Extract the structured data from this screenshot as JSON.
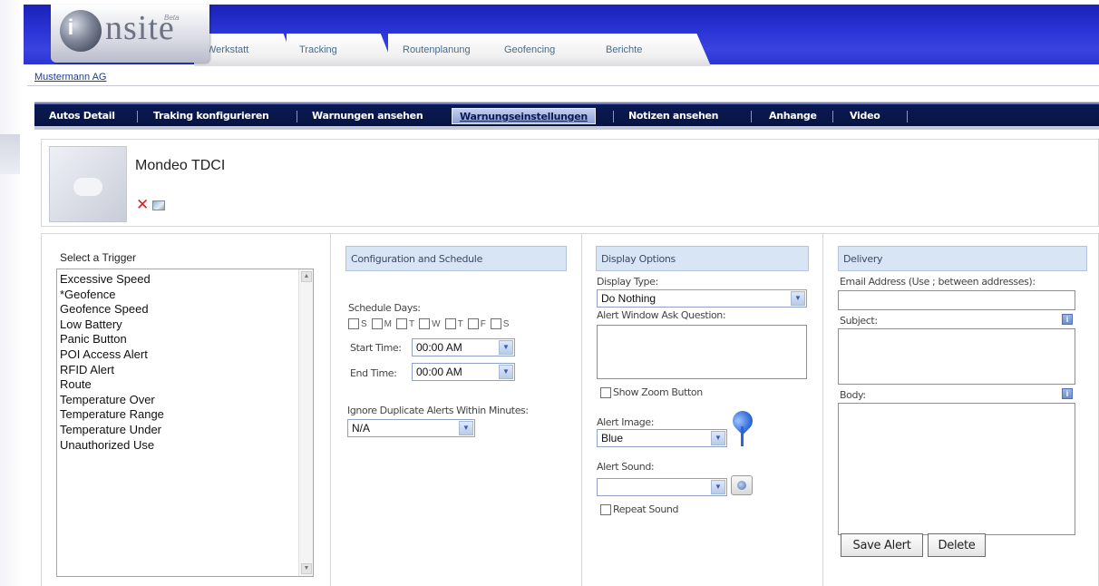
{
  "logo": {
    "ball_letter": "i",
    "word": "nsite",
    "sup": "Beta"
  },
  "tabs": [
    "Werkstatt",
    "Tracking",
    "Routenplanung",
    "Geofencing",
    "Berichte"
  ],
  "company": "Mustermann AG",
  "subnav": {
    "items": [
      "Autos Detail",
      "Traking konfigurieren",
      "Warnungen ansehen",
      "Warnungseinstellungen",
      "Notizen ansehen",
      "Anhange",
      "Video"
    ],
    "active": "Warnungseinstellungen"
  },
  "vehicle": {
    "name": "Mondeo TDCI"
  },
  "trigger": {
    "title": "Select a Trigger",
    "items": [
      "Excessive Speed",
      "*Geofence",
      "Geofence Speed",
      "Low Battery",
      "Panic Button",
      "POI Access Alert",
      "RFID Alert",
      "Route",
      "Temperature Over",
      "Temperature Range",
      "Temperature Under",
      "Unauthorized Use"
    ]
  },
  "config": {
    "header": "Configuration and Schedule",
    "schedule_days_label": "Schedule Days:",
    "days": [
      "S",
      "M",
      "T",
      "W",
      "T",
      "F",
      "S"
    ],
    "start_label": "Start Time:",
    "start_value": "00:00 AM",
    "end_label": "End Time:",
    "end_value": "00:00 AM",
    "ignore_label": "Ignore Duplicate Alerts Within Minutes:",
    "ignore_value": "N/A"
  },
  "display": {
    "header": "Display Options",
    "type_label": "Display Type:",
    "type_value": "Do Nothing",
    "question_label": "Alert Window Ask Question:",
    "zoom_label": "Show Zoom Button",
    "image_label": "Alert Image:",
    "image_value": "Blue",
    "sound_label": "Alert Sound:",
    "sound_value": "",
    "repeat_label": "Repeat Sound"
  },
  "delivery": {
    "header": "Delivery",
    "email_label": "Email Address (Use ; between addresses):",
    "subject_label": "Subject:",
    "body_label": "Body:",
    "save_label": "Save Alert",
    "delete_label": "Delete"
  },
  "colors": {
    "header_blue": "#2b34d6",
    "subnav_navy": "#0a1a55",
    "panel_head": "#d8e5f4"
  }
}
